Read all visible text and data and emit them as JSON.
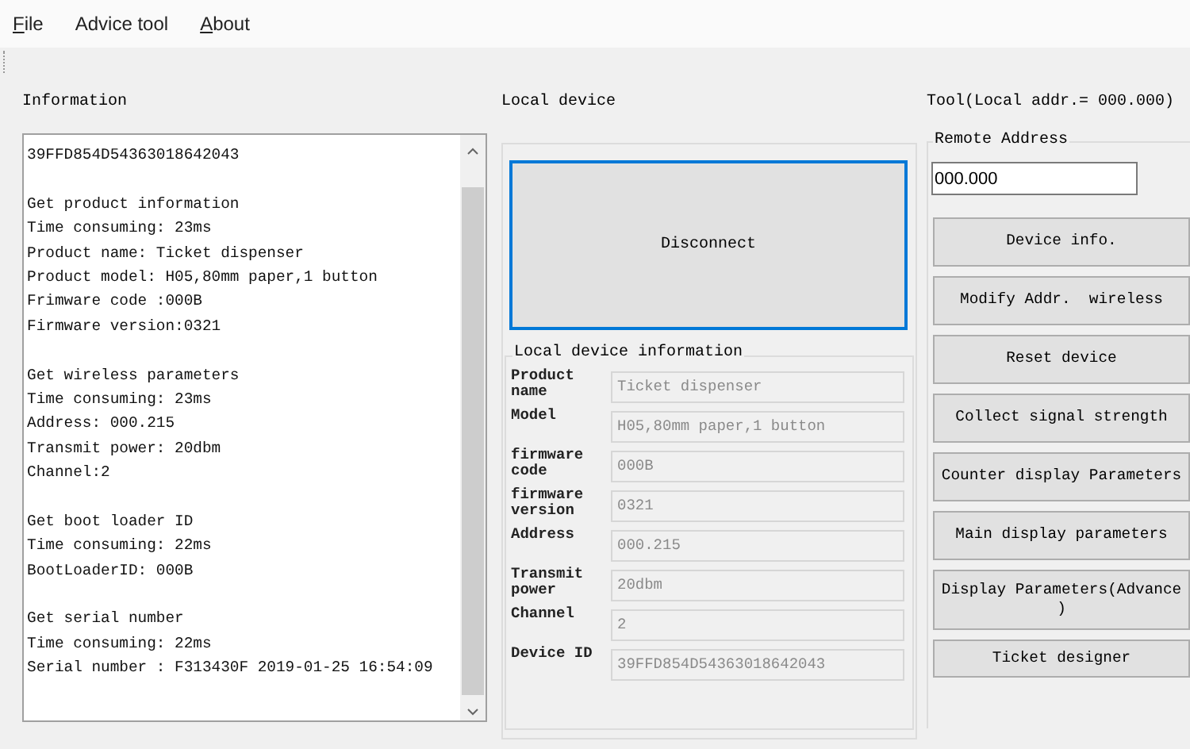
{
  "menu": [
    {
      "label": "File",
      "mnemonic": true
    },
    {
      "label": "Advice tool",
      "mnemonic": false
    },
    {
      "label": "About",
      "mnemonic": true
    }
  ],
  "information": {
    "title": "Information",
    "blocks": [
      [
        "39FFD854D54363018642043"
      ],
      [
        "Get product information",
        "Time consuming: 23ms",
        "Product name: Ticket dispenser",
        "Product model: H05,80mm paper,1 button",
        "Frimware code :000B",
        "Firmware version:0321"
      ],
      [
        "Get wireless parameters",
        "Time consuming: 23ms",
        "Address: 000.215",
        "Transmit power: 20dbm",
        "Channel:2"
      ],
      [
        "Get boot loader ID",
        "Time consuming: 22ms",
        "BootLoaderID: 000B"
      ],
      [
        "Get serial number",
        "Time consuming: 22ms",
        "Serial number : F313430F 2019-01-25 16:54:09"
      ]
    ]
  },
  "local_device": {
    "title": "Local device",
    "connect_button": {
      "label": "Disconnect",
      "focused": true
    },
    "info_group": {
      "title": "Local device information",
      "fields": [
        {
          "label": "Product name",
          "value": "Ticket dispenser",
          "disabled": true
        },
        {
          "label": "Model",
          "value": "H05,80mm paper,1 button",
          "disabled": true
        },
        {
          "label": "firmware code",
          "value": "000B",
          "disabled": true
        },
        {
          "label": "firmware version",
          "value": "0321",
          "disabled": true
        },
        {
          "label": "Address",
          "value": "000.215",
          "disabled": true
        },
        {
          "label": "Transmit power",
          "value": "20dbm",
          "disabled": true
        },
        {
          "label": "Channel",
          "value": "2",
          "disabled": true
        },
        {
          "label": "Device ID",
          "value": "39FFD854D54363018642043",
          "disabled": true
        }
      ]
    }
  },
  "tool": {
    "title": "Tool(Local addr.= 000.000)",
    "remote_address": {
      "title": "Remote Address",
      "value": "000.000"
    },
    "buttons": [
      "Device info.",
      "Modify Addr.  wireless",
      "Reset device",
      "Collect signal strength",
      "Counter display Parameters",
      "Main display parameters",
      "Display Parameters(Advance )",
      "Ticket designer"
    ]
  }
}
